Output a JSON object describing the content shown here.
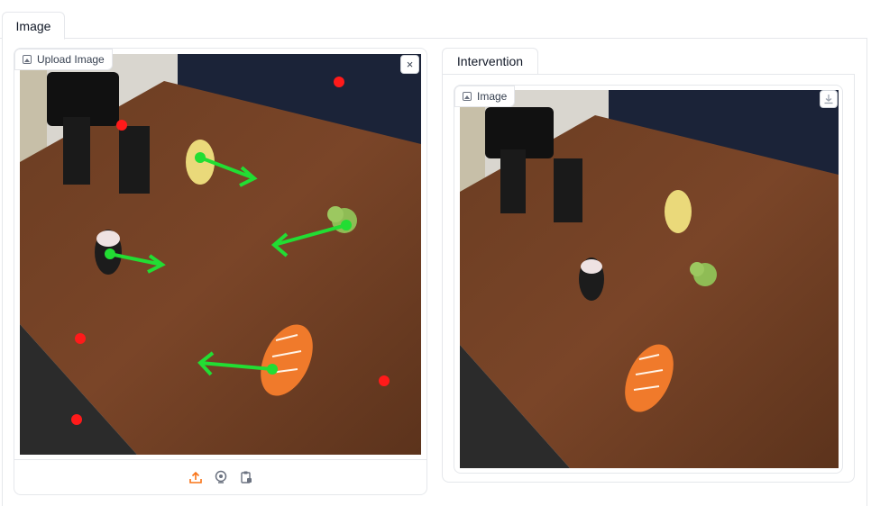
{
  "tabs": {
    "outer": [
      {
        "label": "Image"
      }
    ],
    "inner": [
      {
        "label": "Intervention"
      }
    ]
  },
  "input_panel": {
    "label": "Upload Image",
    "close_glyph": "×",
    "toolbar": {
      "icons": [
        "upload-icon",
        "webcam-icon",
        "clipboard-icon"
      ],
      "accent": "#f97316"
    }
  },
  "output_panel": {
    "label": "Image",
    "download_icon": "download-icon"
  },
  "annotations": {
    "point_color": "#ff1a1a",
    "arrow_color": "#22dd33"
  }
}
